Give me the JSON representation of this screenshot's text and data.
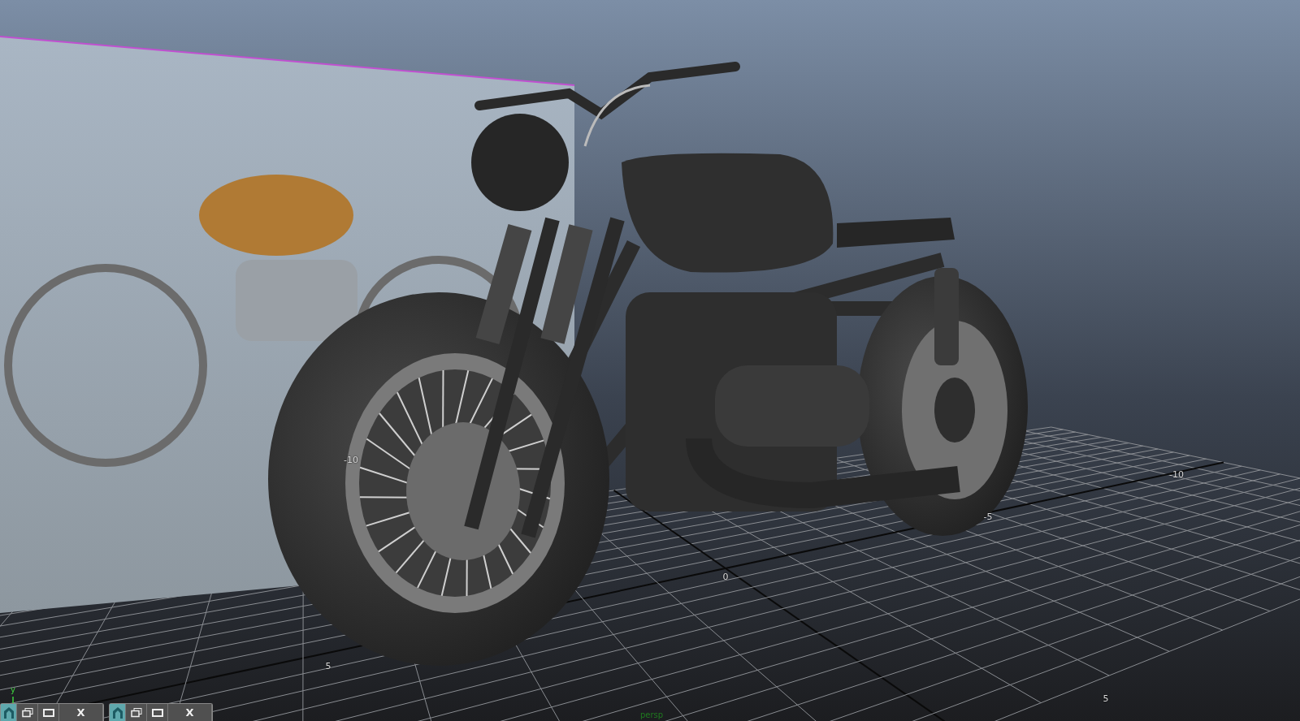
{
  "viewport": {
    "camera": "persp",
    "axis_label": "y",
    "grid_labels": [
      {
        "text": "-10"
      },
      {
        "text": "0"
      },
      {
        "text": "5"
      },
      {
        "text": "-10"
      },
      {
        "text": "-5"
      },
      {
        "text": "5"
      }
    ]
  },
  "minimized_windows": [
    {
      "close": "X"
    },
    {
      "close": "X"
    }
  ]
}
